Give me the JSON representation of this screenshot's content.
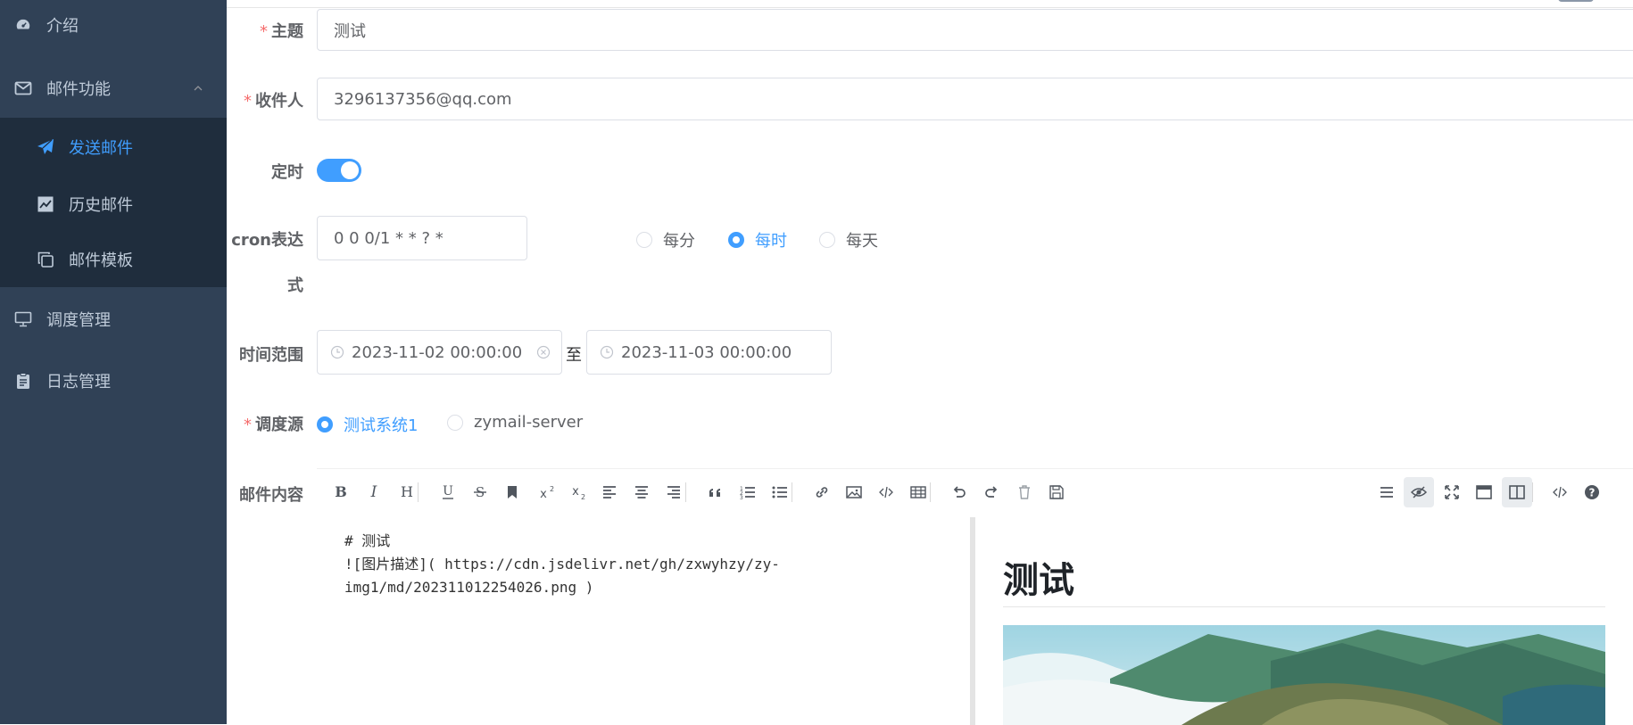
{
  "sidebar": {
    "items": [
      {
        "label": "介绍",
        "icon": "dashboard-icon"
      },
      {
        "label": "邮件功能",
        "icon": "mail-icon",
        "expanded": true
      },
      {
        "label": "发送邮件",
        "icon": "send-icon",
        "active": true
      },
      {
        "label": "历史邮件",
        "icon": "chart-icon"
      },
      {
        "label": "邮件模板",
        "icon": "copy-icon"
      },
      {
        "label": "调度管理",
        "icon": "monitor-icon"
      },
      {
        "label": "日志管理",
        "icon": "clipboard-icon"
      }
    ]
  },
  "form": {
    "subject": {
      "label": "主题",
      "value": "测试"
    },
    "recipient": {
      "label": "收件人",
      "value": "3296137356@qq.com"
    },
    "timer": {
      "label": "定时",
      "enabled": true
    },
    "cron": {
      "label_line1": "cron表达",
      "label_line2": "式",
      "value": "0 0 0/1 * * ? *",
      "options": [
        "每分",
        "每时",
        "每天"
      ],
      "selected": "每时"
    },
    "time_range": {
      "label": "时间范围",
      "start": "2023-11-02 00:00:00",
      "separator": "至",
      "end": "2023-11-03 00:00:00"
    },
    "source": {
      "label": "调度源",
      "options": [
        "测试系统1",
        "zymail-server"
      ],
      "selected": "测试系统1"
    },
    "content": {
      "label": "邮件内容"
    }
  },
  "editor": {
    "toolbar_left": [
      "bold-icon",
      "italic-icon",
      "heading-icon",
      "underline-icon",
      "strikethrough-icon",
      "bookmark-icon",
      "superscript-icon",
      "subscript-icon",
      "align-left-icon",
      "align-center-icon",
      "align-right-icon",
      "quote-icon",
      "ordered-list-icon",
      "unordered-list-icon",
      "link-icon",
      "image-icon",
      "code-icon",
      "table-icon",
      "undo-icon",
      "redo-icon",
      "trash-icon",
      "save-icon"
    ],
    "toolbar_right": [
      "navigation-icon",
      "preview-toggle-icon",
      "fullscreen-icon",
      "fullscreen-window-icon",
      "split-view-icon",
      "html-code-icon",
      "help-icon"
    ],
    "source_line1": "# 测试",
    "source_line2": "![图片描述]( https://cdn.jsdelivr.net/gh/zxwyhzy/zy-",
    "source_line3": "img1/md/202311012254026.png )",
    "preview_title": "测试"
  },
  "colors": {
    "sidebar_bg": "#304156",
    "submenu_bg": "#1f2d3d",
    "accent": "#409eff",
    "required": "#f56c6c"
  }
}
